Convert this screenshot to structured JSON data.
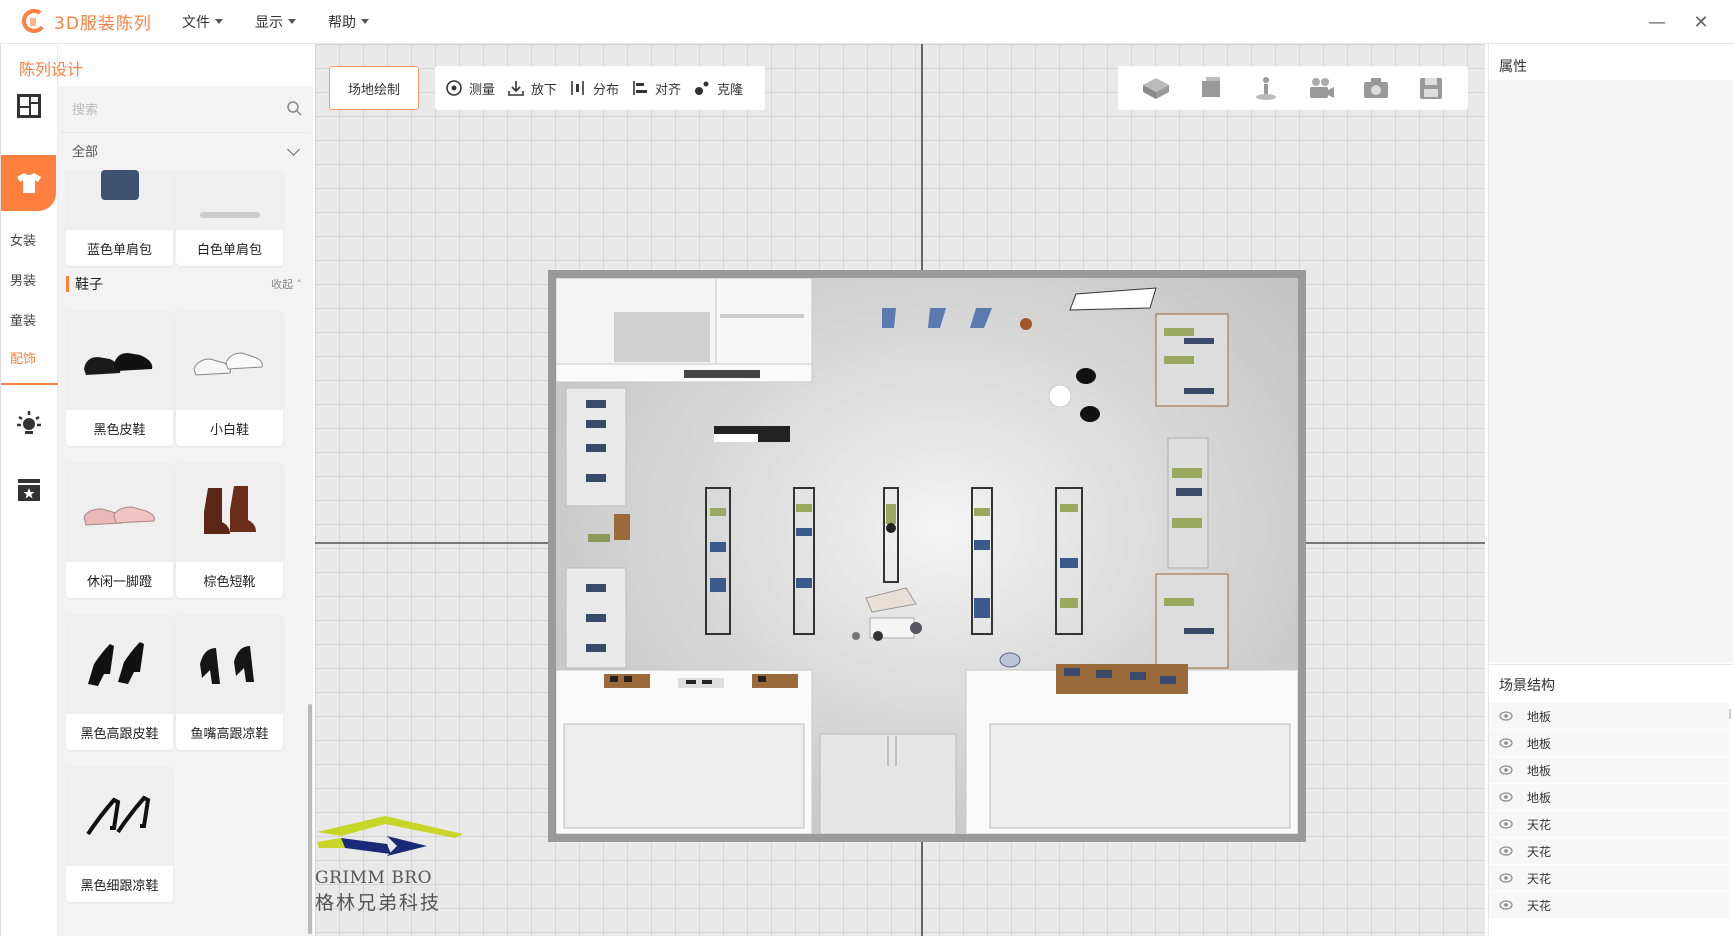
{
  "app": {
    "title": "3D服装陈列"
  },
  "menu": [
    {
      "label": "文件"
    },
    {
      "label": "显示"
    },
    {
      "label": "帮助"
    }
  ],
  "window": {
    "minimize": "—",
    "close": "✕"
  },
  "rail": {
    "tabs": [
      {
        "label": "女装"
      },
      {
        "label": "男装"
      },
      {
        "label": "童装"
      },
      {
        "label": "配饰"
      }
    ],
    "active_tab": "配饰"
  },
  "catalog": {
    "title": "陈列设计",
    "search_placeholder": "搜索",
    "filter_value": "全部",
    "top_items": [
      {
        "label": "蓝色单肩包"
      },
      {
        "label": "白色单肩包"
      }
    ],
    "section": {
      "title": "鞋子",
      "collapse_label": "收起"
    },
    "items": [
      {
        "label": "黑色皮鞋"
      },
      {
        "label": "小白鞋"
      },
      {
        "label": "休闲一脚蹬"
      },
      {
        "label": "棕色短靴"
      },
      {
        "label": "黑色高跟皮鞋"
      },
      {
        "label": "鱼嘴高跟凉鞋"
      },
      {
        "label": "黑色细跟凉鞋"
      }
    ]
  },
  "toolbar": {
    "draw_site": "场地绘制",
    "tools": [
      {
        "label": "测量"
      },
      {
        "label": "放下"
      },
      {
        "label": "分布"
      },
      {
        "label": "对齐"
      },
      {
        "label": "克隆"
      }
    ]
  },
  "watermark": {
    "en": "GRIMM BRO",
    "cn": "格林兄弟科技"
  },
  "properties": {
    "title": "属性"
  },
  "scene": {
    "title": "场景结构",
    "rows": [
      {
        "label": "地板"
      },
      {
        "label": "地板"
      },
      {
        "label": "地板"
      },
      {
        "label": "地板"
      },
      {
        "label": "天花"
      },
      {
        "label": "天花"
      },
      {
        "label": "天花"
      },
      {
        "label": "天花"
      }
    ]
  },
  "colors": {
    "accent": "#ff7f3f",
    "canvas": "#e9e9e9",
    "grid": "#d4d4d4"
  }
}
